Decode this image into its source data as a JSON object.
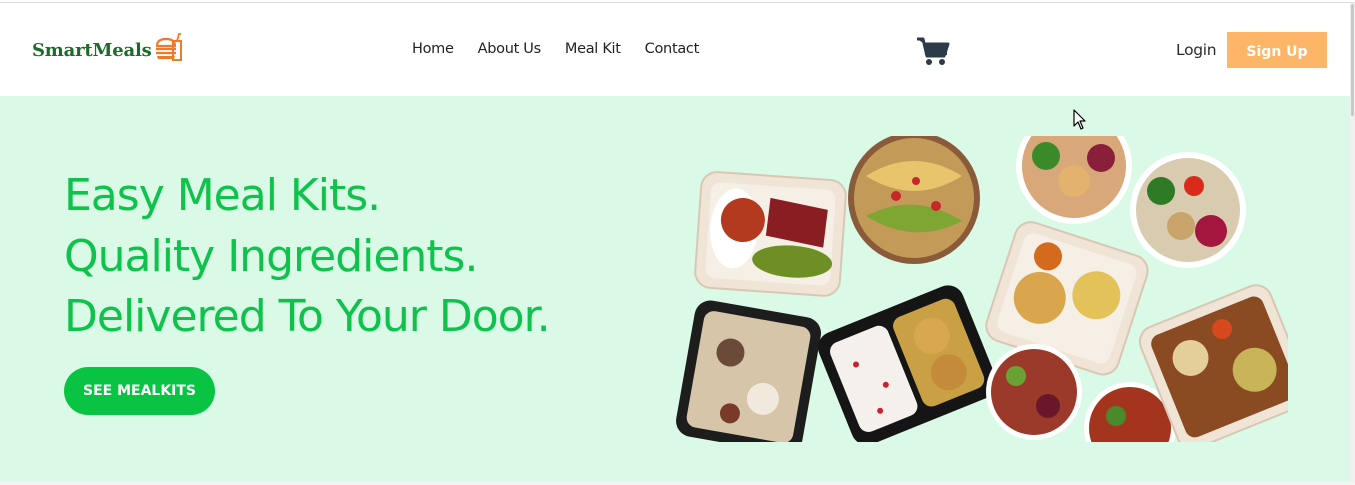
{
  "brand": {
    "name": "SmartMeals",
    "logo_icon": "burger-bag-icon",
    "color": "#1c6b2a",
    "icon_color": "#f07a2a"
  },
  "nav": {
    "items": [
      "Home",
      "About Us",
      "Meal Kit",
      "Contact"
    ]
  },
  "header": {
    "cart_icon": "shopping-cart-icon",
    "login_label": "Login",
    "signup_label": "Sign Up",
    "signup_color": "#fdb668"
  },
  "hero": {
    "lines": [
      "Easy Meal Kits.",
      "Quality Ingredients.",
      "Delivered To Your Door."
    ],
    "cta_label": "SEE MEALKITS",
    "background": "#daf9e6",
    "accent": "#0ec24c"
  }
}
